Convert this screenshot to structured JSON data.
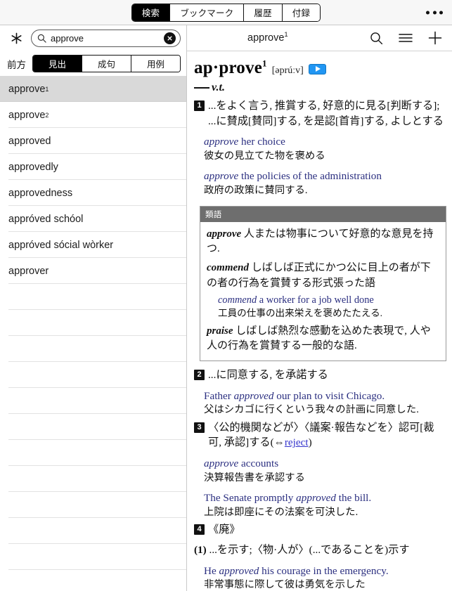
{
  "topbar": {
    "tabs": [
      {
        "label": "検索",
        "active": true
      },
      {
        "label": "ブックマーク",
        "active": false
      },
      {
        "label": "履歴",
        "active": false
      },
      {
        "label": "付録",
        "active": false
      }
    ],
    "overflow_icon": "more-horizontal-icon"
  },
  "sidebar": {
    "asterisk_icon": "asterisk-icon",
    "search": {
      "icon": "search-icon",
      "value": "approve",
      "placeholder": "検索",
      "clear_icon": "clear-circle-icon"
    },
    "filter": {
      "label": "前方",
      "options": [
        {
          "label": "見出",
          "active": true
        },
        {
          "label": "成句",
          "active": false
        },
        {
          "label": "用例",
          "active": false
        }
      ]
    },
    "results": [
      {
        "word": "approve",
        "sup": "1",
        "selected": true
      },
      {
        "word": "approve",
        "sup": "2",
        "selected": false
      },
      {
        "word": "approved",
        "sup": "",
        "selected": false
      },
      {
        "word": "approvedly",
        "sup": "",
        "selected": false
      },
      {
        "word": "approvedness",
        "sup": "",
        "selected": false
      },
      {
        "word": "appróved schóol",
        "sup": "",
        "selected": false
      },
      {
        "word": "appróved sócial wòrker",
        "sup": "",
        "selected": false
      },
      {
        "word": "approver",
        "sup": "",
        "selected": false
      }
    ],
    "empty_row_count": 10
  },
  "content_header": {
    "title": "approve",
    "title_sup": "1",
    "icons": [
      "search-icon",
      "menu-icon",
      "plus-icon"
    ]
  },
  "entry": {
    "headword": "ap·prove",
    "headword_sup": "1",
    "ipa": "[əprúːv]",
    "audio_icon": "play-audio-icon",
    "pos": "v.t.",
    "senses": [
      {
        "number": "1",
        "definition": "...をよく言う, 推賞する, 好意的に見る[判断する]; ...に賛成[賛同]する, を是認[首肯]する, よしとする",
        "examples": [
          {
            "en_pre": "",
            "en_ital": "approve",
            "en_post": " her choice",
            "jp": "彼女の見立てた物を褒める"
          },
          {
            "en_pre": "",
            "en_ital": "approve",
            "en_post": " the policies of the administration",
            "jp": "政府の政策に賛同する."
          }
        ]
      },
      {
        "number": "2",
        "definition": "...に同意する, を承諾する",
        "examples": [
          {
            "en_pre": "Father ",
            "en_ital": "approved",
            "en_post": " our plan to visit Chicago.",
            "jp": "父はシカゴに行くという我々の計画に同意した."
          }
        ]
      },
      {
        "number": "3",
        "definition_pre": "〈公的機関などが〉〈議案·報告などを〉認可[裁可, 承認]する(⇔",
        "definition_link": "reject",
        "definition_post": ")",
        "examples": [
          {
            "en_pre": "",
            "en_ital": "approve",
            "en_post": " accounts",
            "jp": "決算報告書を承認する"
          },
          {
            "en_pre": "The Senate promptly ",
            "en_ital": "approved",
            "en_post": " the bill.",
            "jp": "上院は即座にその法案を可決した."
          }
        ]
      },
      {
        "number": "4",
        "definition": "《廃》",
        "sub_senses": [
          {
            "label": "(1)",
            "text": "...を示す;〈物·人が〉(...であることを)示す",
            "examples": [
              {
                "en_pre": "He ",
                "en_ital": "approved",
                "en_post": " his courage in the emergency.",
                "jp": "非常事態に際して彼は勇気を示した"
              }
            ]
          }
        ]
      }
    ],
    "synonym_box": {
      "header": "類語",
      "items": [
        {
          "word": "approve",
          "text": " 人または物事について好意的な意見を持つ.",
          "examples": []
        },
        {
          "word": "commend",
          "text": " しばしば正式にかつ公に目上の者が下の者の行為を賞賛する形式張った語",
          "examples": [
            {
              "en_pre": "",
              "en_ital": "commend",
              "en_post": " a worker for a job well done",
              "jp": "工員の仕事の出来栄えを褒めたたえる."
            }
          ]
        },
        {
          "word": "praise",
          "text": " しばしば熱烈な感動を込めた表現で, 人や人の行為を賞賛する一般的な語.",
          "examples": []
        }
      ]
    }
  },
  "colors": {
    "accent_blue": "#2196f3",
    "example_text": "#2b2f80",
    "link": "#3333cc",
    "selected_row": "#d9d9d9",
    "syn_header_bg": "#6e6e6e"
  }
}
